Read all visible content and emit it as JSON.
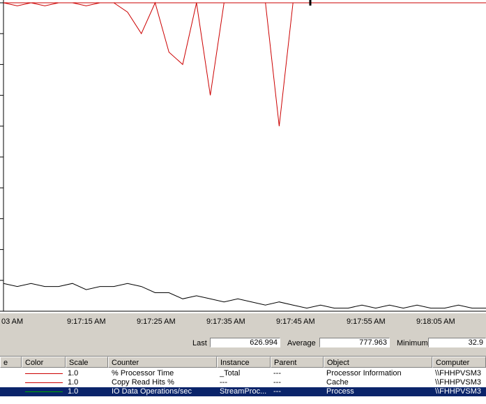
{
  "chart": {
    "colors": {
      "processor_time": "#cc0000",
      "copy_read_hits": "#cc0000",
      "io_ops": "#000000",
      "grid": "#c0c0c0"
    },
    "time_labels": [
      "03 AM",
      "9:17:15 AM",
      "9:17:25 AM",
      "9:17:35 AM",
      "9:17:45 AM",
      "9:17:55 AM",
      "9:18:05 AM"
    ]
  },
  "chart_data": {
    "type": "line",
    "x": [
      "9:17:05 AM",
      "9:17:07 AM",
      "9:17:09 AM",
      "9:17:11 AM",
      "9:17:13 AM",
      "9:17:15 AM",
      "9:17:17 AM",
      "9:17:19 AM",
      "9:17:21 AM",
      "9:17:23 AM",
      "9:17:25 AM",
      "9:17:27 AM",
      "9:17:29 AM",
      "9:17:31 AM",
      "9:17:33 AM",
      "9:17:35 AM",
      "9:17:37 AM",
      "9:17:39 AM",
      "9:17:41 AM",
      "9:17:43 AM",
      "9:17:45 AM",
      "9:17:47 AM",
      "9:17:49 AM",
      "9:17:51 AM",
      "9:17:53 AM",
      "9:17:55 AM",
      "9:17:57 AM",
      "9:17:59 AM",
      "9:18:01 AM",
      "9:18:03 AM",
      "9:18:05 AM",
      "9:18:07 AM",
      "9:18:09 AM",
      "9:18:11 AM",
      "9:18:13 AM",
      "9:18:15 AM"
    ],
    "series": [
      {
        "name": "% Processor Time",
        "values": [
          100,
          99,
          100,
          99,
          100,
          100,
          99,
          100,
          100,
          97,
          90,
          100,
          84,
          80,
          100,
          70,
          100,
          100,
          100,
          100,
          60,
          100,
          100,
          100,
          100,
          100,
          100,
          100,
          100,
          100,
          100,
          100,
          100,
          100,
          100,
          100
        ]
      },
      {
        "name": "Copy Read Hits %",
        "values": [
          100,
          100,
          100,
          100,
          100,
          100,
          100,
          100,
          100,
          100,
          100,
          100,
          100,
          100,
          100,
          100,
          100,
          100,
          100,
          100,
          100,
          100,
          100,
          100,
          100,
          100,
          100,
          100,
          100,
          100,
          100,
          100,
          100,
          100,
          100,
          100
        ]
      },
      {
        "name": "IO Data Operations/sec",
        "values": [
          9,
          8,
          9,
          8,
          8,
          9,
          7,
          8,
          8,
          9,
          8,
          6,
          6,
          4,
          5,
          4,
          3,
          4,
          3,
          2,
          3,
          2,
          1,
          2,
          1,
          1,
          2,
          1,
          2,
          1,
          2,
          1,
          1,
          2,
          1,
          1
        ]
      }
    ],
    "ylim": [
      0,
      100
    ]
  },
  "stats": {
    "last_label": "Last",
    "last_value": "626.994",
    "average_label": "Average",
    "average_value": "777.963",
    "minimum_label": "Minimum",
    "minimum_value": "32.9"
  },
  "counter_list": {
    "columns": [
      "e",
      "Color",
      "Scale",
      "Counter",
      "Instance",
      "Parent",
      "Object",
      "Computer"
    ],
    "rows": [
      {
        "scale": "1.0",
        "counter": "% Processor Time",
        "instance": "_Total",
        "parent": "---",
        "object": "Processor Information",
        "computer": "\\\\FHHPVSM3",
        "color": "#cc0000",
        "selected": false
      },
      {
        "scale": "1.0",
        "counter": "Copy Read Hits %",
        "instance": "---",
        "parent": "---",
        "object": "Cache",
        "computer": "\\\\FHHPVSM3",
        "color": "#cc0000",
        "selected": false
      },
      {
        "scale": "1.0",
        "counter": "IO Data Operations/sec",
        "instance": "StreamProc...",
        "parent": "---",
        "object": "Process",
        "computer": "\\\\FHHPVSM3",
        "color": "#00aa00",
        "selected": true
      }
    ]
  }
}
